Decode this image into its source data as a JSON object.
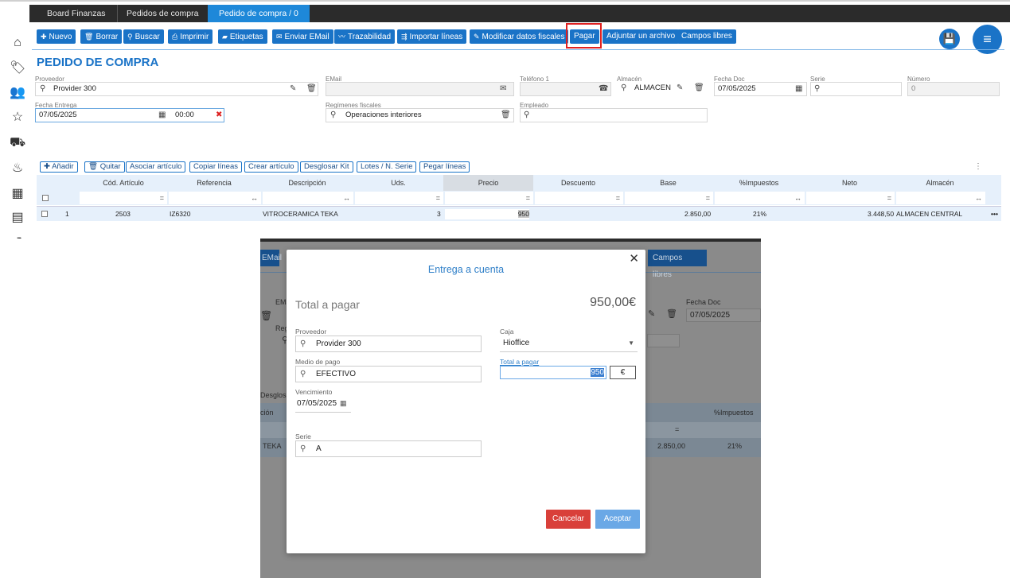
{
  "topbar": {
    "tabs": [
      {
        "label": "Board Finanzas"
      },
      {
        "label": "Pedidos de compra"
      },
      {
        "label": "Pedido de compra / 0"
      }
    ]
  },
  "toolbar": {
    "nuevo": "Nuevo",
    "borrar": "Borrar",
    "buscar": "Buscar",
    "imprimir": "Imprimir",
    "etiquetas": "Etiquetas",
    "enviar_email": "Enviar EMail",
    "trazabilidad": "Trazabilidad",
    "importar_lineas": "Importar líneas",
    "modificar_fiscales": "Modificar datos fiscales",
    "pagar": "Pagar",
    "adjuntar": "Adjuntar un archivo",
    "campos_libres": "Campos libres"
  },
  "page": {
    "title": "PEDIDO DE COMPRA",
    "proveedor_label": "Proveedor",
    "proveedor_value": "Provider 300",
    "email_label": "EMail",
    "telefono_label": "Teléfono 1",
    "almacen_label": "Almacén",
    "almacen_value": "ALMACEN",
    "fecha_doc_label": "Fecha Doc",
    "fecha_doc_value": "07/05/2025",
    "serie_label": "Serie",
    "numero_label": "Número",
    "numero_value": "0",
    "fecha_entrega_label": "Fecha Entrega",
    "fecha_entrega_value": "07/05/2025",
    "hora_entrega_value": "00:00",
    "regimenes_label": "Regímenes fiscales",
    "regimenes_value": "Operaciones interiores",
    "empleado_label": "Empleado"
  },
  "grid_toolbar": {
    "anadir": "Añadir",
    "quitar": "Quitar",
    "asociar": "Asociar artículo",
    "copiar": "Copiar líneas",
    "crear": "Crear artículo",
    "desglosar": "Desglosar Kit",
    "lotes": "Lotes / N. Serie",
    "pegar": "Pegar líneas"
  },
  "grid": {
    "columns": [
      "Cód. Artículo",
      "Referencia",
      "Descripción",
      "Uds.",
      "Precio",
      "Descuento",
      "Base",
      "%Impuestos",
      "Neto",
      "Almacén"
    ],
    "filter_symbols": {
      "eq": "=",
      "range": "↔"
    },
    "rows": [
      {
        "line": "1",
        "cod": "2503",
        "referencia": "IZ6320",
        "descripcion": "VITROCERAMICA TEKA",
        "uds": "3",
        "precio": "950",
        "base": "2.850,00",
        "impuestos": "21%",
        "neto": "3.448,50",
        "almacen": "ALMACEN CENTRAL",
        "more": "•••"
      }
    ]
  },
  "dialog_bg": {
    "email_btn": "EMail",
    "campos_libres": "Campos libres",
    "email_label": "EMa",
    "regi_label": "Reg",
    "fecha_doc_label": "Fecha Doc",
    "fecha_doc_value": "07/05/2025",
    "desglosa": "Desglosa",
    "cion": "ción",
    "impuestos_col": "%Impuestos",
    "eq": "=",
    "teka": "TEKA",
    "base": "2.850,00",
    "impuestos": "21%"
  },
  "modal": {
    "title": "Entrega a cuenta",
    "total_label": "Total a pagar",
    "total_value": "950,00€",
    "proveedor_label": "Proveedor",
    "proveedor_value": "Provider 300",
    "caja_label": "Caja",
    "caja_value": "Hioffice",
    "medio_label": "Medio de pago",
    "medio_value": "EFECTIVO",
    "total_pagar_label": "Total a pagar",
    "total_pagar_value": "950",
    "currency": "€",
    "vencimiento_label": "Vencimiento",
    "vencimiento_value": "07/05/2025",
    "serie_label": "Serie",
    "serie_value": "A",
    "cancelar": "Cancelar",
    "aceptar": "Aceptar"
  },
  "colors": {
    "primary": "#1a73c7",
    "topbar": "#2b2b2b",
    "active_tab": "#1e88d9",
    "cancel": "#d9403a",
    "accept": "#6aa8e6",
    "highlight_outline": "#e02020"
  }
}
